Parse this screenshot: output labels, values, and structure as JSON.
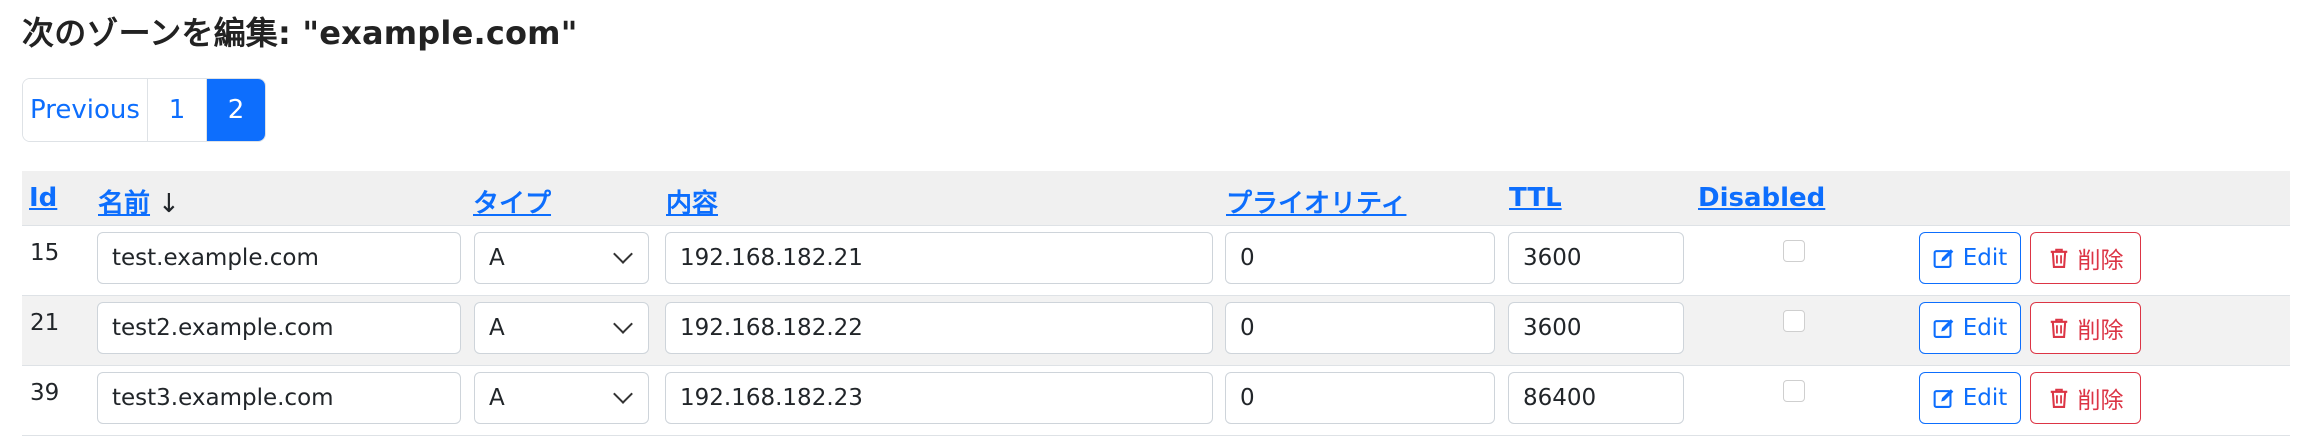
{
  "page": {
    "title": "次のゾーンを編集: \"example.com\""
  },
  "pagination": {
    "previous": "Previous",
    "pages": [
      "1",
      "2"
    ],
    "current": "2"
  },
  "table": {
    "headers": {
      "id": "Id",
      "name": "名前",
      "sort_indicator": "↓",
      "type": "タイプ",
      "content": "内容",
      "priority": "プライオリティ",
      "ttl": "TTL",
      "disabled": "Disabled"
    },
    "rows": [
      {
        "id": "15",
        "name": "test.example.com",
        "type": "A",
        "content": "192.168.182.21",
        "priority": "0",
        "ttl": "3600",
        "disabled": false
      },
      {
        "id": "21",
        "name": "test2.example.com",
        "type": "A",
        "content": "192.168.182.22",
        "priority": "0",
        "ttl": "3600",
        "disabled": false
      },
      {
        "id": "39",
        "name": "test3.example.com",
        "type": "A",
        "content": "192.168.182.23",
        "priority": "0",
        "ttl": "86400",
        "disabled": false
      }
    ],
    "actions": {
      "edit_label": "Edit",
      "delete_label": "削除"
    }
  },
  "colors": {
    "primary": "#0d6efd",
    "danger": "#dc3545",
    "header_bg": "#f0f0f0",
    "stripe_bg": "#f2f2f2"
  },
  "icons": {
    "edit": "pencil-square-icon",
    "delete": "trash-icon",
    "sort": "arrow-down-icon",
    "select": "chevron-down-icon"
  }
}
